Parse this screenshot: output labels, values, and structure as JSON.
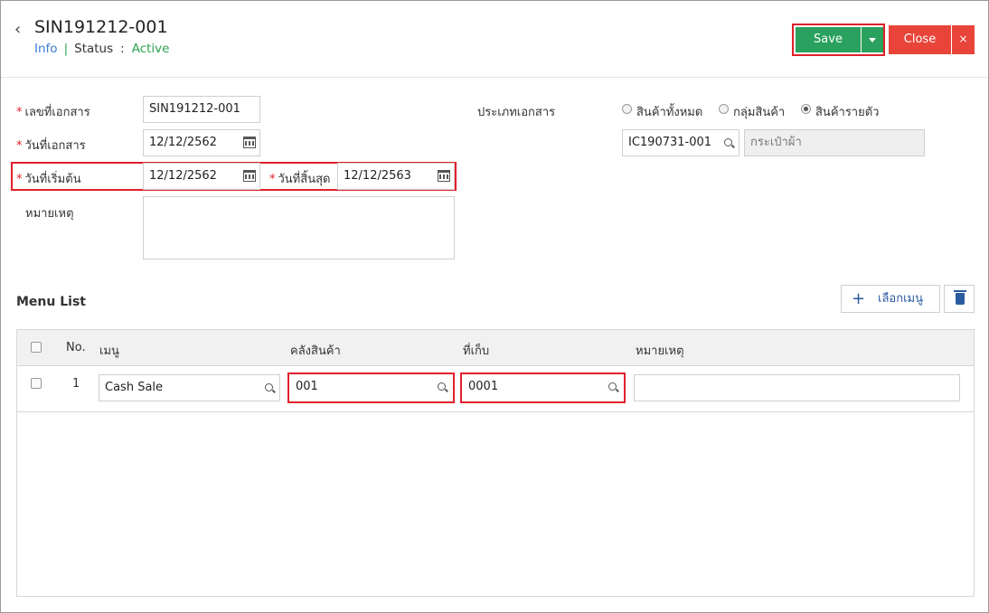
{
  "header": {
    "doc_no": "SIN191212-001",
    "info": "Info",
    "divider": "|",
    "status_label": "Status",
    "colon": ":",
    "status_value": "Active",
    "save_label": "Save",
    "close_label": "Close",
    "close_x": "×"
  },
  "form": {
    "doc_no_label": "เลขที่เอกสาร",
    "doc_no_value": "SIN191212-001",
    "doc_date_label": "วันที่เอกสาร",
    "doc_date_value": "12/12/2562",
    "start_label": "วันที่เริ่มต้น",
    "start_value": "12/12/2562",
    "end_label": "วันที่สิ้นสุด",
    "end_value": "12/12/2563",
    "note_label": "หมายเหตุ",
    "doc_type_label": "ประเภทเอกสาร",
    "type_options": [
      "สินค้าทั้งหมด",
      "กลุ่มสินค้า",
      "สินค้ารายตัว"
    ],
    "type_selected": "สินค้ารายตัว",
    "product_code": "IC190731-001",
    "product_name": "กระเป๋าผ้า"
  },
  "menu_list": {
    "title": "Menu List",
    "add_label": "เลือกเมนู",
    "columns": [
      "No.",
      "เมนู",
      "คลังสินค้า",
      "ที่เก็บ",
      "หมายเหตุ"
    ],
    "rows": [
      {
        "no": "1",
        "menu": "Cash Sale",
        "warehouse": "001",
        "location": "0001",
        "note": ""
      }
    ]
  }
}
